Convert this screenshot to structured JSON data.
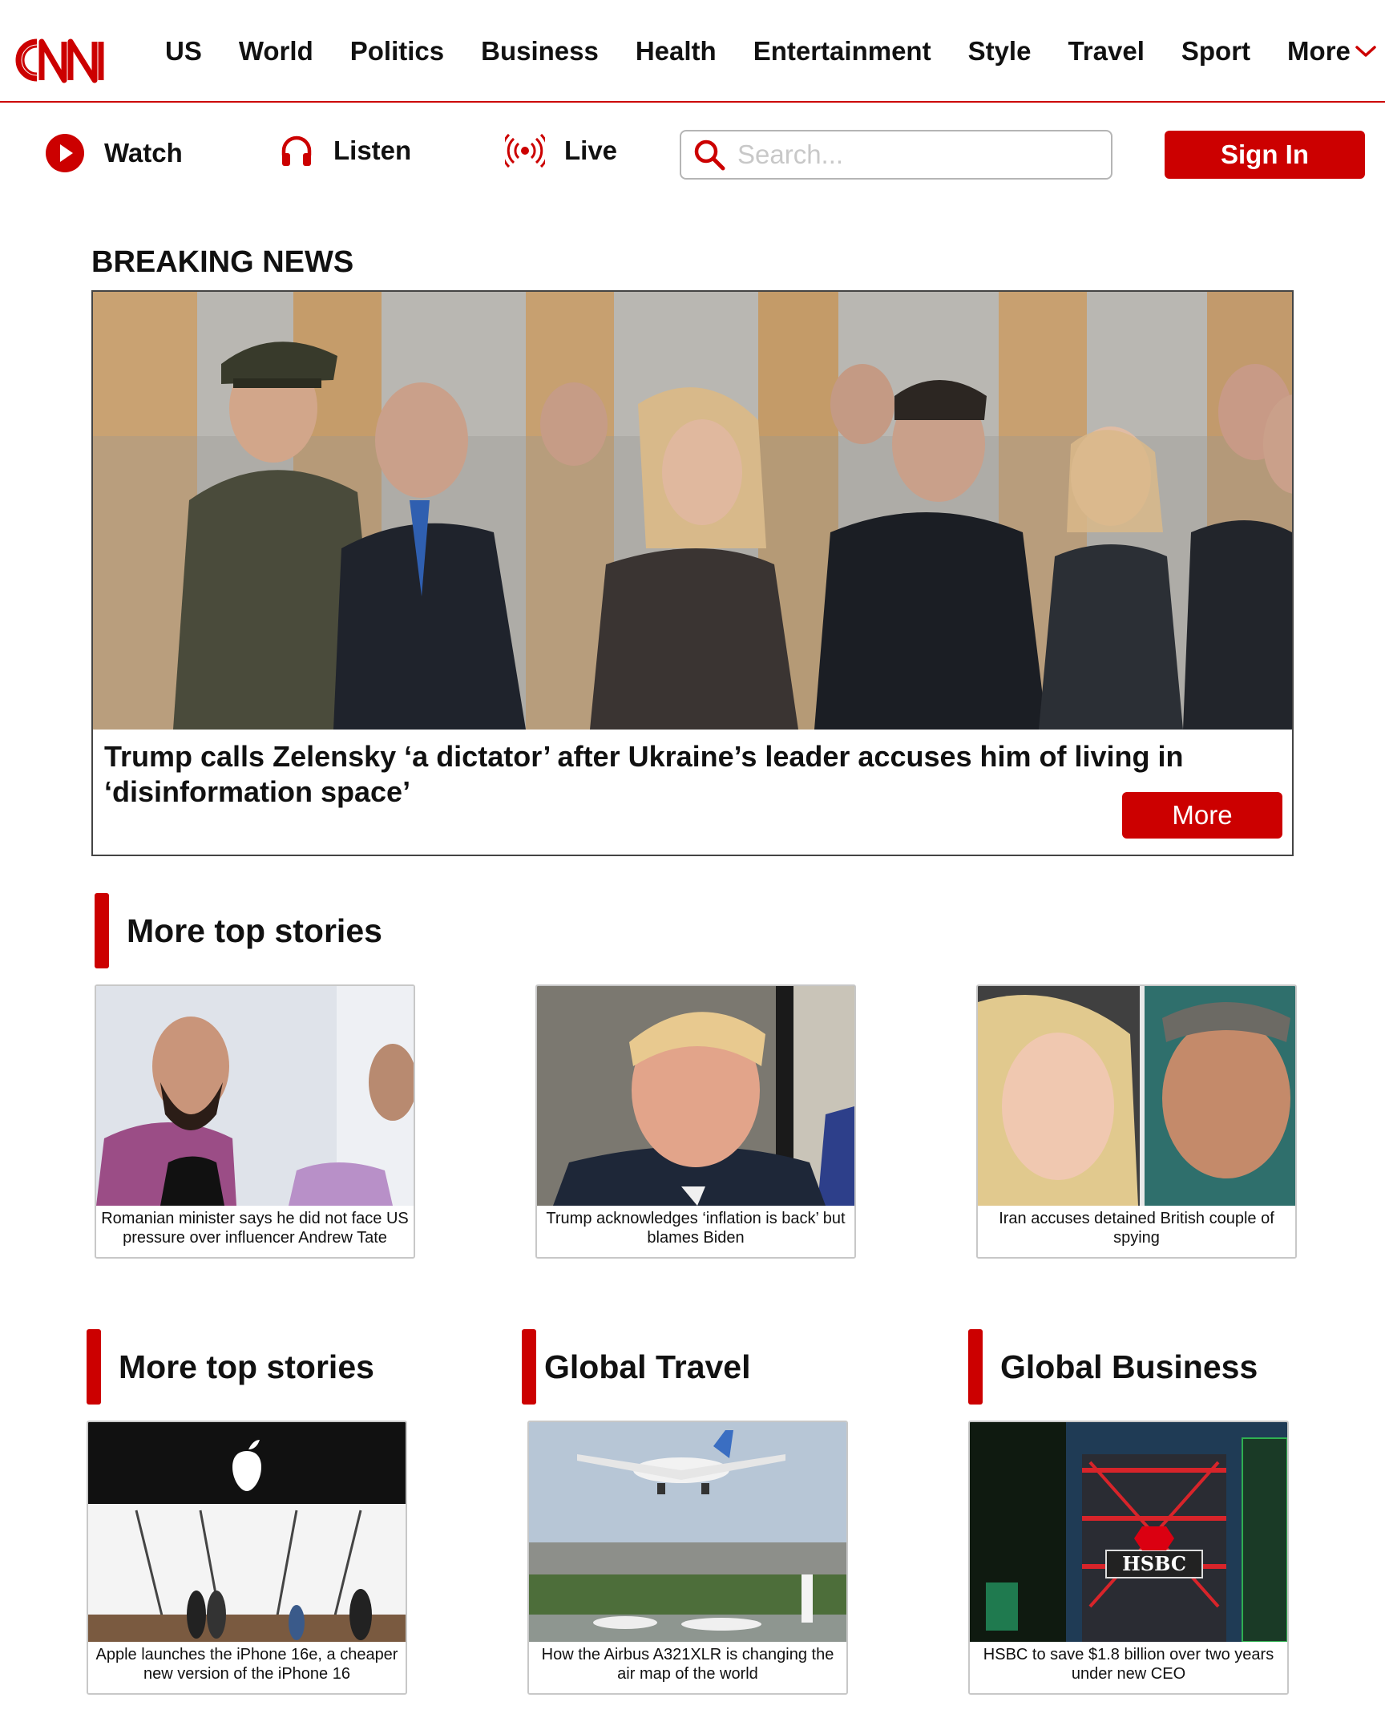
{
  "brand": {
    "logo_text": "CNN",
    "accent_color": "#cc0000"
  },
  "nav": {
    "links": [
      "US",
      "World",
      "Politics",
      "Business",
      "Health",
      "Entertainment",
      "Style",
      "Travel",
      "Sport"
    ],
    "more_label": "More"
  },
  "subbar": {
    "watch_label": "Watch",
    "listen_label": "Listen",
    "live_label": "Live",
    "search_placeholder": "Search...",
    "signin_label": "Sign In"
  },
  "breaking": {
    "label": "BREAKING NEWS",
    "headline": "Trump calls Zelensky ‘a dictator’ after Ukraine’s leader accuses him of living in ‘disinformation space’",
    "more_label": "More"
  },
  "top_stories": {
    "title": "More top stories",
    "cards": [
      {
        "caption": "Romanian minister says he did not face US pressure over influencer Andrew Tate"
      },
      {
        "caption": "Trump acknowledges ‘inflation is back’ but blames Biden"
      },
      {
        "caption": "Iran accuses detained British couple of spying"
      }
    ]
  },
  "sections": [
    {
      "title": "More top stories",
      "caption": "Apple launches the iPhone 16e, a cheaper new version of the iPhone 16"
    },
    {
      "title": "Global Travel",
      "caption": "How the Airbus A321XLR is changing the air map of the world"
    },
    {
      "title": "Global Business",
      "caption": "HSBC to save $1.8 billion over two years under new CEO"
    }
  ]
}
